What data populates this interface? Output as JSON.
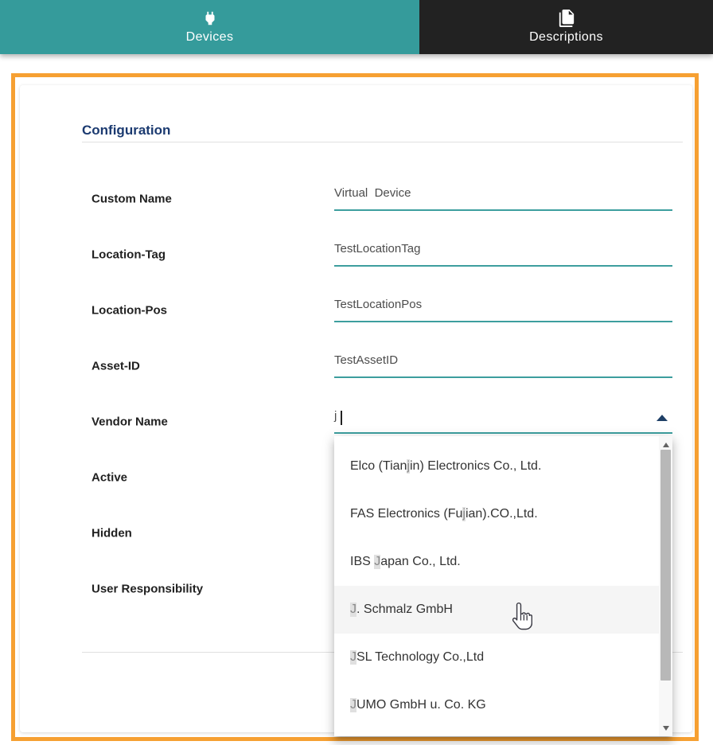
{
  "tabs": [
    {
      "label": "Devices",
      "icon": "power-plug-icon"
    },
    {
      "label": "Descriptions",
      "icon": "documents-icon"
    }
  ],
  "panel": {
    "title": "Configuration"
  },
  "fields": [
    {
      "label": "Custom Name",
      "value": "Virtual  Device"
    },
    {
      "label": "Location-Tag",
      "value": "TestLocationTag"
    },
    {
      "label": "Location-Pos",
      "value": "TestLocationPos"
    },
    {
      "label": "Asset-ID",
      "value": "TestAssetID"
    },
    {
      "label": "Vendor Name",
      "value": "j"
    }
  ],
  "toggle_fields": [
    {
      "label": "Active"
    },
    {
      "label": "Hidden"
    },
    {
      "label": "User Responsibility"
    }
  ],
  "dropdown": {
    "items": [
      {
        "pre": "Elco (Tian",
        "match": "j",
        "post": "in) Electronics Co., Ltd."
      },
      {
        "pre": "FAS Electronics (Fu",
        "match": "j",
        "post": "ian).CO.,Ltd."
      },
      {
        "pre": "IBS ",
        "match": "J",
        "post": "apan Co., Ltd."
      },
      {
        "pre": "",
        "match": "J",
        "post": ". Schmalz GmbH"
      },
      {
        "pre": "",
        "match": "J",
        "post": "SL Technology Co.,Ltd"
      },
      {
        "pre": "",
        "match": "J",
        "post": "UMO GmbH u. Co. KG"
      }
    ]
  },
  "colors": {
    "tab_active_bg": "#359b9b",
    "tab_inactive_bg": "#222222",
    "frame_orange": "#f6a032",
    "title_navy": "#1b3a70",
    "underline_teal": "#3d9e9e",
    "match_highlight_bg": "#e0e0e0"
  }
}
